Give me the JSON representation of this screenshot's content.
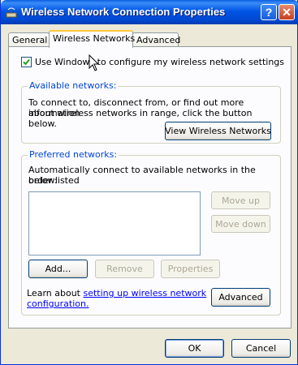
{
  "window": {
    "title": "Wireless Network Connection Properties",
    "help_label": "?",
    "close_label": "✕"
  },
  "tabs": [
    {
      "label": "General",
      "active": false
    },
    {
      "label": "Wireless Networks",
      "active": true
    },
    {
      "label": "Advanced",
      "active": false
    }
  ],
  "options": {
    "use_windows_label": "Use Windows to configure my wireless network settings",
    "use_windows_checked": true
  },
  "available": {
    "label": "Available networks:",
    "description_line1": "To connect to, disconnect from, or find out more information",
    "description_line2": "about wireless networks in range, click the button below.",
    "view_button": "View Wireless Networks"
  },
  "preferred": {
    "label": "Preferred networks:",
    "description_line1": "Automatically connect to available networks in the order listed",
    "description_line2": "below:",
    "networks": [],
    "move_up": "Move up",
    "move_down": "Move down",
    "add": "Add...",
    "remove": "Remove",
    "properties": "Properties"
  },
  "learn": {
    "prefix": "Learn about ",
    "link_line1": "setting up wireless network",
    "link_line2": "configuration.",
    "suffix": ""
  },
  "advanced_button": "Advanced",
  "footer": {
    "ok": "OK",
    "cancel": "Cancel"
  },
  "colors": {
    "title_bar": "#0055e5",
    "group_label": "#0046d5",
    "tab_highlight": "#ffc83c",
    "link": "#0000ff"
  },
  "icons": {
    "title": "wireless-network-icon",
    "cursor": "mouse-pointer-icon"
  }
}
